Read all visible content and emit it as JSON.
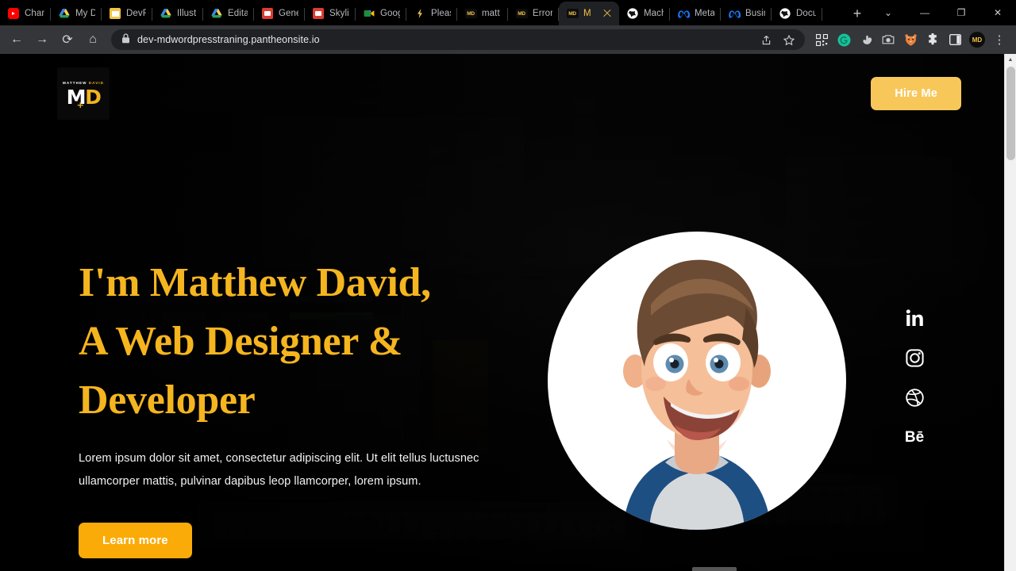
{
  "browser": {
    "tabs": [
      {
        "label": "Chan",
        "favicon": "youtube-icon",
        "active": false
      },
      {
        "label": "My D",
        "favicon": "drive-icon",
        "active": false
      },
      {
        "label": "DevF",
        "favicon": "note-icon",
        "active": false
      },
      {
        "label": "Illust",
        "favicon": "drive-icon",
        "active": false
      },
      {
        "label": "Edita",
        "favicon": "drive-icon",
        "active": false
      },
      {
        "label": "Gene",
        "favicon": "slides-icon",
        "active": false
      },
      {
        "label": "Skylin",
        "favicon": "slides-icon",
        "active": false
      },
      {
        "label": "Goog",
        "favicon": "meet-icon",
        "active": false
      },
      {
        "label": "Pleas",
        "favicon": "bolt-icon",
        "active": false
      },
      {
        "label": "matt",
        "favicon": "md-icon",
        "active": false
      },
      {
        "label": "Error",
        "favicon": "md-icon",
        "active": false
      },
      {
        "label": "M",
        "favicon": "md-icon",
        "active": true
      },
      {
        "label": "Mach",
        "favicon": "globe-icon",
        "active": false
      },
      {
        "label": "Meta",
        "favicon": "meta-icon",
        "active": false
      },
      {
        "label": "Busin",
        "favicon": "meta-icon",
        "active": false
      },
      {
        "label": "Docu",
        "favicon": "globe-icon",
        "active": false
      }
    ],
    "new_tab_label": "+",
    "window_controls": {
      "tab_search": "⌄",
      "minimize": "—",
      "maximize": "❐",
      "close": "✕"
    },
    "toolbar": {
      "back": "←",
      "forward": "→",
      "reload": "⟳",
      "home": "⌂",
      "lock_icon": "lock-icon",
      "url": "dev-mdwordpresstraning.pantheonsite.io",
      "share": "share-icon",
      "bookmark": "star-icon",
      "extensions": [
        {
          "name": "qr-code-icon",
          "glyph": "▦",
          "color": "#e9eaec"
        },
        {
          "name": "grammarly-icon",
          "glyph": "G",
          "color": "#15c39a"
        },
        {
          "name": "hand-cursor-icon",
          "glyph": "☚",
          "color": "#c9cbce"
        },
        {
          "name": "camera-icon",
          "glyph": "▣",
          "color": "#c9cbce"
        },
        {
          "name": "fox-icon",
          "glyph": "🦊",
          "color": "#e8833a"
        },
        {
          "name": "puzzle-icon",
          "glyph": "🧩",
          "color": "#d2d4d7"
        },
        {
          "name": "side-panel-icon",
          "glyph": "▯",
          "color": "#e3e5e8"
        },
        {
          "name": "profile-avatar",
          "glyph": "MD",
          "color": "#f3c242"
        },
        {
          "name": "chrome-menu-icon",
          "glyph": "⋮",
          "color": "#d2d4d7"
        }
      ]
    },
    "scrollbar": {
      "up_arrow": "▲"
    }
  },
  "site": {
    "logo": {
      "top_first": "MATTHEW",
      "top_second": "DAVID",
      "mono_m": "M",
      "mono_d": "D",
      "plus": "+"
    },
    "hire_button": "Hire Me",
    "hero": {
      "title_lines": [
        "I'm Matthew David,",
        "A Web Designer &",
        "Developer"
      ],
      "paragraph": "Lorem ipsum dolor sit amet, consectetur adipiscing elit. Ut elit tellus luctusnec ullamcorper mattis, pulvinar dapibus leop llamcorper, lorem ipsum.",
      "cta_button": "Learn more"
    },
    "social_links": [
      {
        "name": "linkedin-icon",
        "label": "in"
      },
      {
        "name": "instagram-icon",
        "label": "Instagram"
      },
      {
        "name": "dribbble-icon",
        "label": "Dribbble"
      },
      {
        "name": "behance-icon",
        "label": "Bē"
      }
    ],
    "colors": {
      "accent_amber": "#f5b51f",
      "hire_button": "#f8c75a",
      "learn_button": "#fbab07",
      "background": "#0b0b0c",
      "text": "#f2f3f4"
    }
  }
}
